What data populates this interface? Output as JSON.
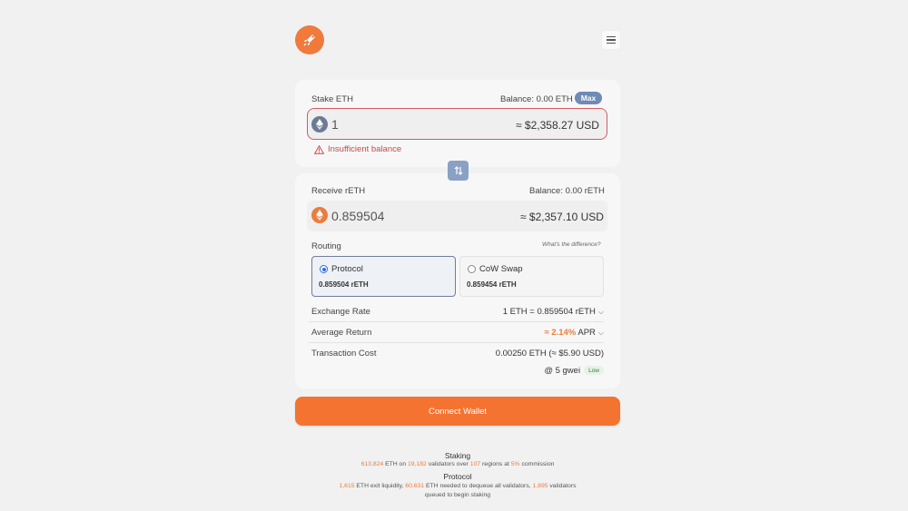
{
  "stake": {
    "label": "Stake ETH",
    "balance": "Balance: 0.00 ETH",
    "max_label": "Max",
    "amount": "1",
    "usd_value": "≈ $2,358.27 USD",
    "error": "Insufficient balance"
  },
  "receive": {
    "label": "Receive rETH",
    "balance": "Balance: 0.00 rETH",
    "amount": "0.859504",
    "usd_value": "≈ $2,357.10 USD"
  },
  "routing": {
    "label": "Routing",
    "help_link": "What's the difference?",
    "options": [
      {
        "name": "Protocol",
        "value": "0.859504 rETH",
        "selected": true
      },
      {
        "name": "CoW Swap",
        "value": "0.859454 rETH",
        "selected": false
      }
    ]
  },
  "details": {
    "exchange_rate_label": "Exchange Rate",
    "exchange_rate_value": "1 ETH = 0.859504 rETH",
    "avg_return_label": "Average Return",
    "avg_return_value": "≈ 2.14%",
    "avg_return_unit": "APR",
    "tx_cost_label": "Transaction Cost",
    "tx_cost_value": "0.00250 ETH (≈ $5.90 USD)",
    "gas_value": "@ 5 gwei",
    "gas_badge": "Low"
  },
  "connect_label": "Connect Wallet",
  "footer": {
    "staking_title": "Staking",
    "staking": {
      "eth": "613,824",
      "t1": " ETH on ",
      "validators": "19,182",
      "t2": " validators over ",
      "regions": "107",
      "t3": " regions at ",
      "commission": "5%",
      "t4": " commission"
    },
    "protocol_title": "Protocol",
    "protocol": {
      "exit": "1,615",
      "t1": " ETH exit liquidity, ",
      "needed": "60,631",
      "t2": " ETH needed to dequeue all validators, ",
      "queued": "1,895",
      "t3": " validators",
      "line2": "queued to begin staking"
    }
  },
  "colors": {
    "accent": "#f47330",
    "error": "#c8484c",
    "max_button": "#6f8bb5"
  }
}
